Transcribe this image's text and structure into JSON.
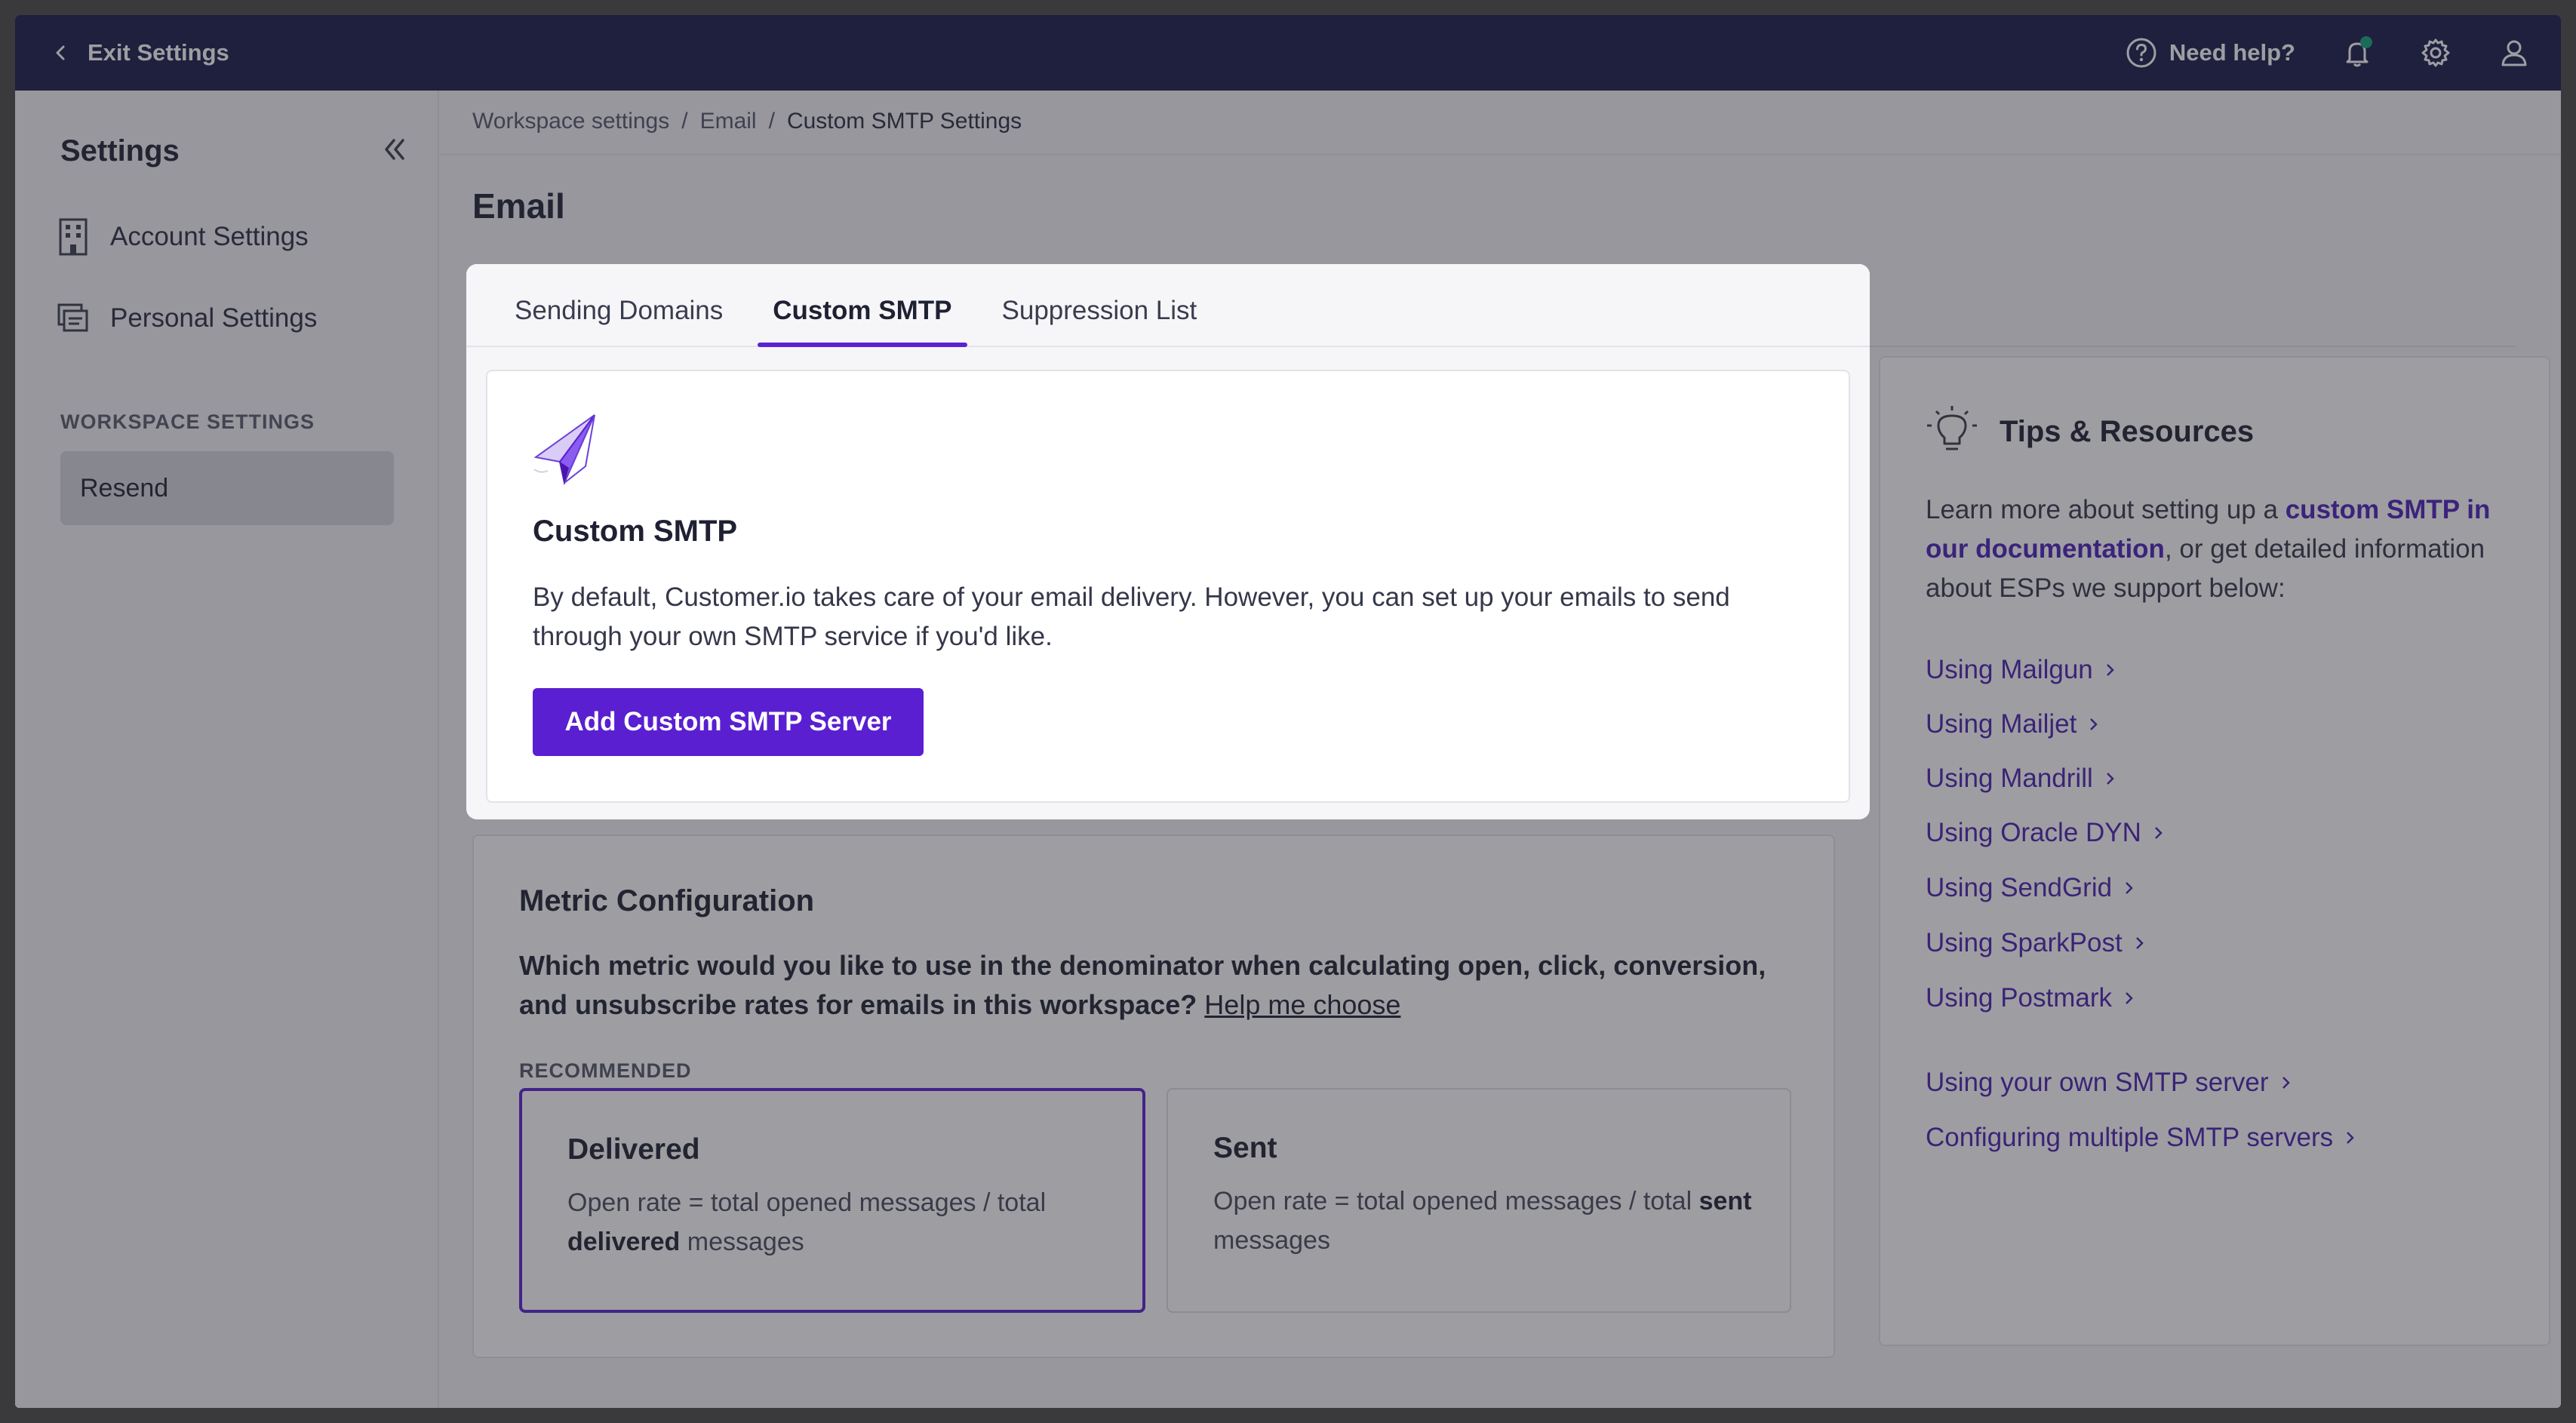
{
  "topbar": {
    "exit_label": "Exit Settings",
    "help_label": "Need help?",
    "icons": [
      "question-circle-icon",
      "bell-icon",
      "gear-icon",
      "user-icon"
    ],
    "notification_dot_color": "#13a07a"
  },
  "sidebar": {
    "title": "Settings",
    "items": [
      {
        "label": "Account Settings",
        "icon": "building-icon"
      },
      {
        "label": "Personal Settings",
        "icon": "cards-icon"
      }
    ],
    "section_label": "WORKSPACE SETTINGS",
    "active_item": "Resend"
  },
  "breadcrumb": {
    "items": [
      "Workspace settings",
      "Email"
    ],
    "separator": "/",
    "current": "Custom SMTP Settings"
  },
  "page": {
    "title": "Email"
  },
  "tabs": [
    {
      "label": "Sending Domains",
      "active": false
    },
    {
      "label": "Custom SMTP",
      "active": true
    },
    {
      "label": "Suppression List",
      "active": false
    }
  ],
  "custom_smtp": {
    "icon": "paper-plane-icon",
    "title": "Custom SMTP",
    "description": "By default, Customer.io takes care of your email delivery. However, you can set up your emails to send through your own SMTP service if you'd like.",
    "button_label": "Add Custom SMTP Server"
  },
  "metric": {
    "title": "Metric Configuration",
    "question": "Which metric would you like to use in the denominator when calculating open, click, conversion, and unsubscribe rates for emails in this workspace?",
    "help_link": "Help me choose",
    "recommended_label": "RECOMMENDED",
    "options": [
      {
        "title": "Delivered",
        "desc_prefix": "Open rate = total opened messages / total",
        "desc_bold": "delivered",
        "desc_suffix": "messages",
        "selected": true
      },
      {
        "title": "Sent",
        "desc_prefix": "Open rate = total opened messages / total",
        "desc_bold": "sent",
        "desc_suffix": "messages",
        "selected": false
      }
    ]
  },
  "tips": {
    "icon": "lightbulb-icon",
    "title": "Tips & Resources",
    "text_prefix": "Learn more about setting up a ",
    "text_link": "custom SMTP in our documentation",
    "text_suffix": ", or get detailed information about ESPs we support below:",
    "links": [
      "Using Mailgun",
      "Using Mailjet",
      "Using Mandrill",
      "Using Oracle DYN",
      "Using SendGrid",
      "Using SparkPost",
      "Using Postmark"
    ],
    "links_extra": [
      "Using your own SMTP server",
      "Configuring multiple SMTP servers"
    ]
  },
  "colors": {
    "topbar": "#181a4a",
    "accent": "#5a1fd1",
    "link": "#4a1fb0"
  }
}
